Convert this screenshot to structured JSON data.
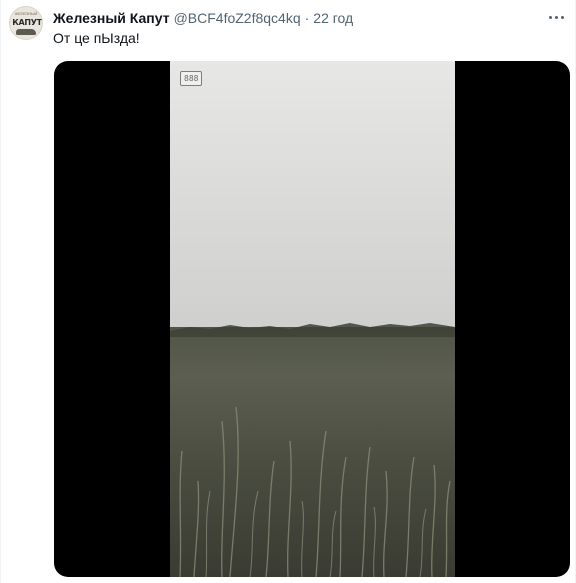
{
  "tweet": {
    "author": {
      "display_name": "Железный Капут",
      "handle": "@BCF4foZ2f8qc4kq",
      "avatar_logo_text": "КАПУТ",
      "avatar_top_text": "ЖЕЛЕЗНЫЙ"
    },
    "separator": "·",
    "time": "22 год",
    "text": "От це пЫзда!",
    "media": {
      "type": "video",
      "overlay_badge": "888"
    }
  },
  "icons": {
    "more": "more-dots-icon"
  }
}
